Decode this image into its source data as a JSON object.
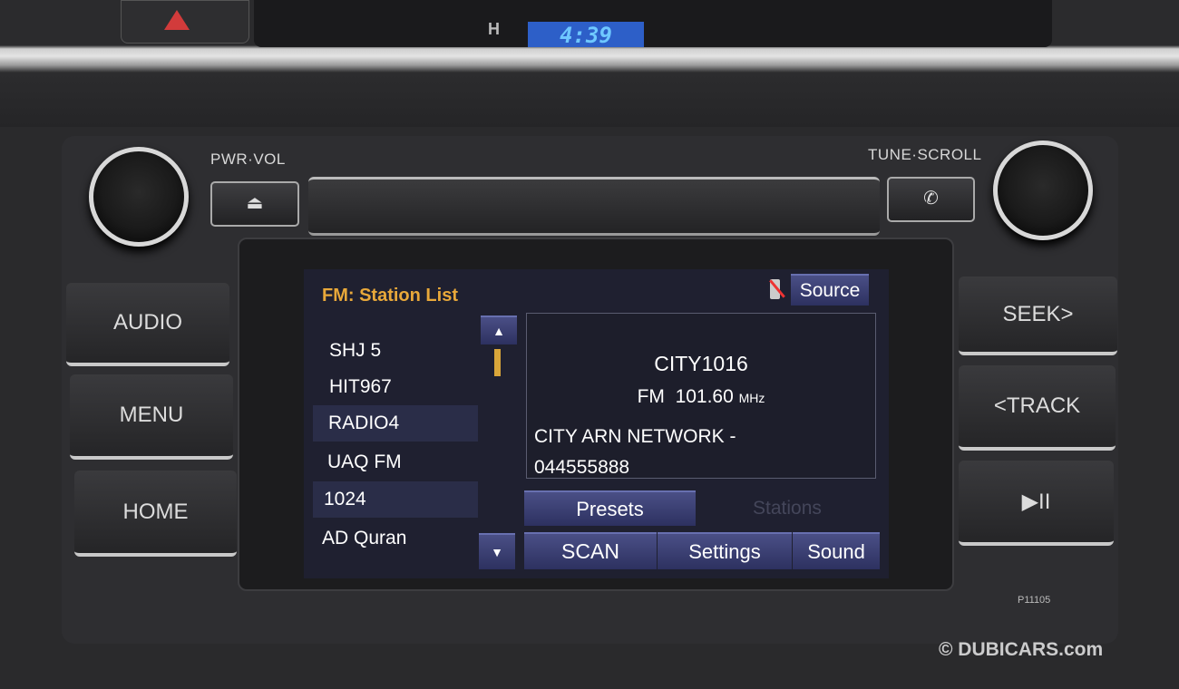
{
  "dashboard": {
    "clock_indicator": "H",
    "clock": "4:39"
  },
  "head_unit": {
    "knob_left_label": "PWR·VOL",
    "knob_right_label": "TUNE·SCROLL",
    "eject_icon": "⏏",
    "phone_icon": "✆",
    "left_buttons": [
      "AUDIO",
      "MENU",
      "HOME"
    ],
    "right_buttons": [
      "SEEK>",
      "<TRACK",
      "▶II"
    ],
    "model_code": "P11105"
  },
  "screen": {
    "title": "FM: Station List",
    "source_label": "Source",
    "title_color": "#e8a83a",
    "stations": [
      {
        "name": "SHJ 5",
        "highlighted": false
      },
      {
        "name": "HIT967",
        "highlighted": false
      },
      {
        "name": "RADIO4",
        "highlighted": true
      },
      {
        "name": "UAQ FM",
        "highlighted": false
      },
      {
        "name": "1024",
        "highlighted": true
      },
      {
        "name": "AD Quran",
        "highlighted": false
      }
    ],
    "now_playing": {
      "station": "CITY1016",
      "band": "FM",
      "frequency": "101.60",
      "unit": "MHz",
      "text_line1": "CITY ARN NETWORK -",
      "text_line2": "044555888"
    },
    "tabs": {
      "presets": "Presets",
      "stations": "Stations"
    },
    "bottom_buttons": [
      "SCAN",
      "Settings",
      "Sound"
    ]
  },
  "watermark": "© DUBICARS.com"
}
